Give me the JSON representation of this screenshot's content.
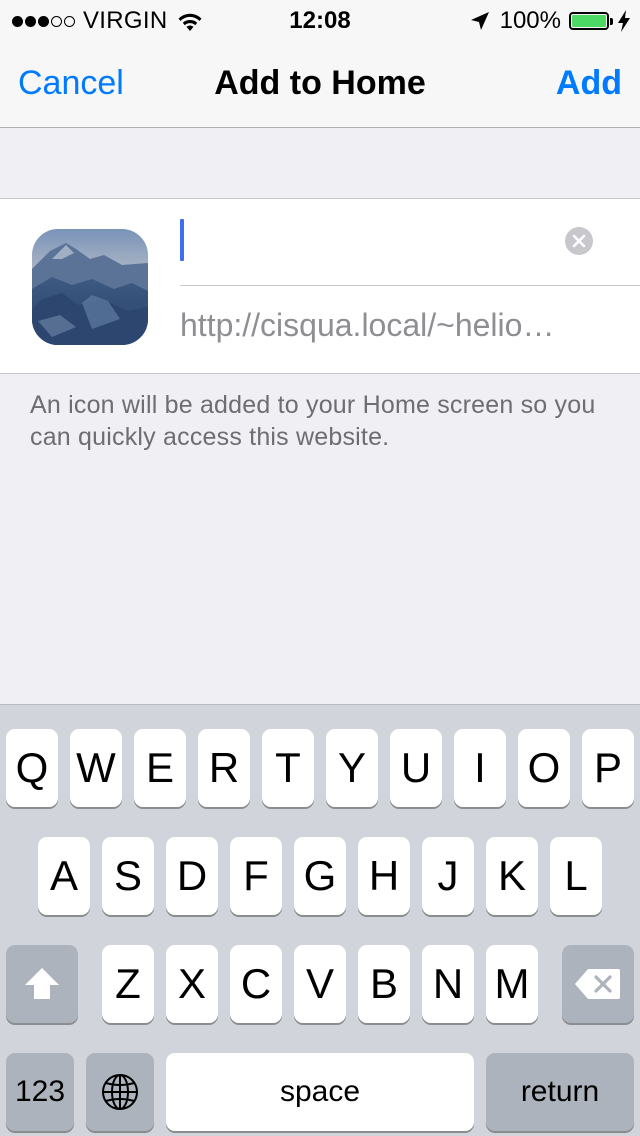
{
  "status_bar": {
    "carrier": "VIRGIN",
    "time": "12:08",
    "battery_percent": "100%",
    "signal_bars_filled": 3,
    "signal_bars_total": 5,
    "battery_level": 1.0,
    "battery_color": "#4cd964",
    "icons": [
      "wifi-icon",
      "location-arrow-icon",
      "battery-icon",
      "charging-bolt-icon"
    ]
  },
  "nav": {
    "cancel_label": "Cancel",
    "title": "Add to Home",
    "add_label": "Add",
    "accent_color": "#007aff"
  },
  "form": {
    "title_value": "",
    "url_text": "http://cisqua.local/~helio…",
    "footer_note": "An icon will be added to your Home screen so you can quickly access this website.",
    "icons": [
      "website-icon-image",
      "clear-text-icon"
    ]
  },
  "keyboard": {
    "row1": [
      "Q",
      "W",
      "E",
      "R",
      "T",
      "Y",
      "U",
      "I",
      "O",
      "P"
    ],
    "row2": [
      "A",
      "S",
      "D",
      "F",
      "G",
      "H",
      "J",
      "K",
      "L"
    ],
    "row3": [
      "Z",
      "X",
      "C",
      "V",
      "B",
      "N",
      "M"
    ],
    "numbers_label": "123",
    "space_label": "space",
    "return_label": "return",
    "icons": [
      "shift-icon",
      "delete-icon",
      "globe-icon"
    ]
  }
}
